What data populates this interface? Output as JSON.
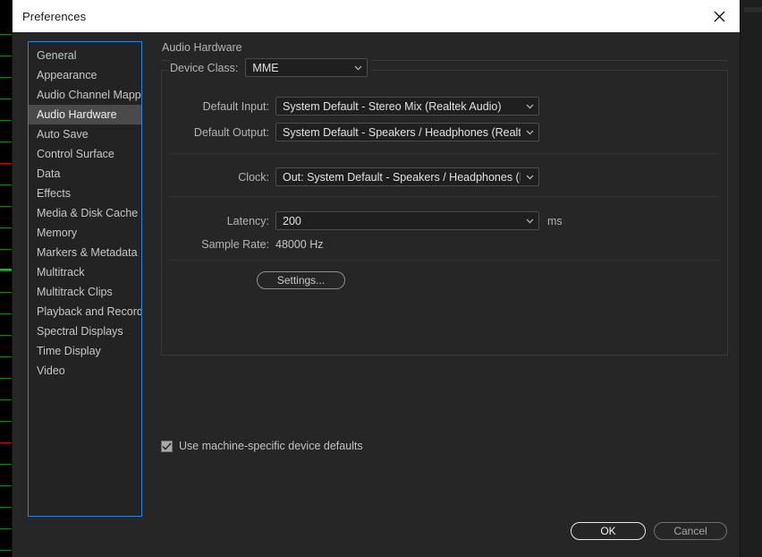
{
  "window": {
    "title": "Preferences",
    "close_icon": "close-icon"
  },
  "sidebar": {
    "items": [
      {
        "label": "General",
        "selected": false
      },
      {
        "label": "Appearance",
        "selected": false
      },
      {
        "label": "Audio Channel Mapping",
        "selected": false
      },
      {
        "label": "Audio Hardware",
        "selected": true
      },
      {
        "label": "Auto Save",
        "selected": false
      },
      {
        "label": "Control Surface",
        "selected": false
      },
      {
        "label": "Data",
        "selected": false
      },
      {
        "label": "Effects",
        "selected": false
      },
      {
        "label": "Media & Disk Cache",
        "selected": false
      },
      {
        "label": "Memory",
        "selected": false
      },
      {
        "label": "Markers & Metadata",
        "selected": false
      },
      {
        "label": "Multitrack",
        "selected": false
      },
      {
        "label": "Multitrack Clips",
        "selected": false
      },
      {
        "label": "Playback and Recording",
        "selected": false
      },
      {
        "label": "Spectral Displays",
        "selected": false
      },
      {
        "label": "Time Display",
        "selected": false
      },
      {
        "label": "Video",
        "selected": false
      }
    ]
  },
  "main": {
    "title": "Audio Hardware",
    "device_class": {
      "label": "Device Class:",
      "value": "MME"
    },
    "default_input": {
      "label": "Default Input:",
      "value": "System Default - Stereo Mix (Realtek Audio)"
    },
    "default_output": {
      "label": "Default Output:",
      "value": "System Default - Speakers / Headphones (Realtek Aud..."
    },
    "clock": {
      "label": "Clock:",
      "value": "Out: System Default - Speakers / Headphones (Realtek..."
    },
    "latency": {
      "label": "Latency:",
      "value": "200",
      "unit": "ms"
    },
    "sample_rate": {
      "label": "Sample Rate:",
      "value": "48000 Hz"
    },
    "settings_button": "Settings...",
    "machine_defaults_checkbox": {
      "label": "Use machine-specific device defaults",
      "checked": true
    }
  },
  "footer": {
    "ok_label": "OK",
    "cancel_label": "Cancel"
  },
  "colors": {
    "accent_focus": "#2f80d8",
    "dialog_bg": "#262626",
    "titlebar_bg": "#ffffff",
    "selection_bg": "#4a4a4a",
    "meter_green": "#1f7a1f",
    "meter_red": "#c01010"
  }
}
